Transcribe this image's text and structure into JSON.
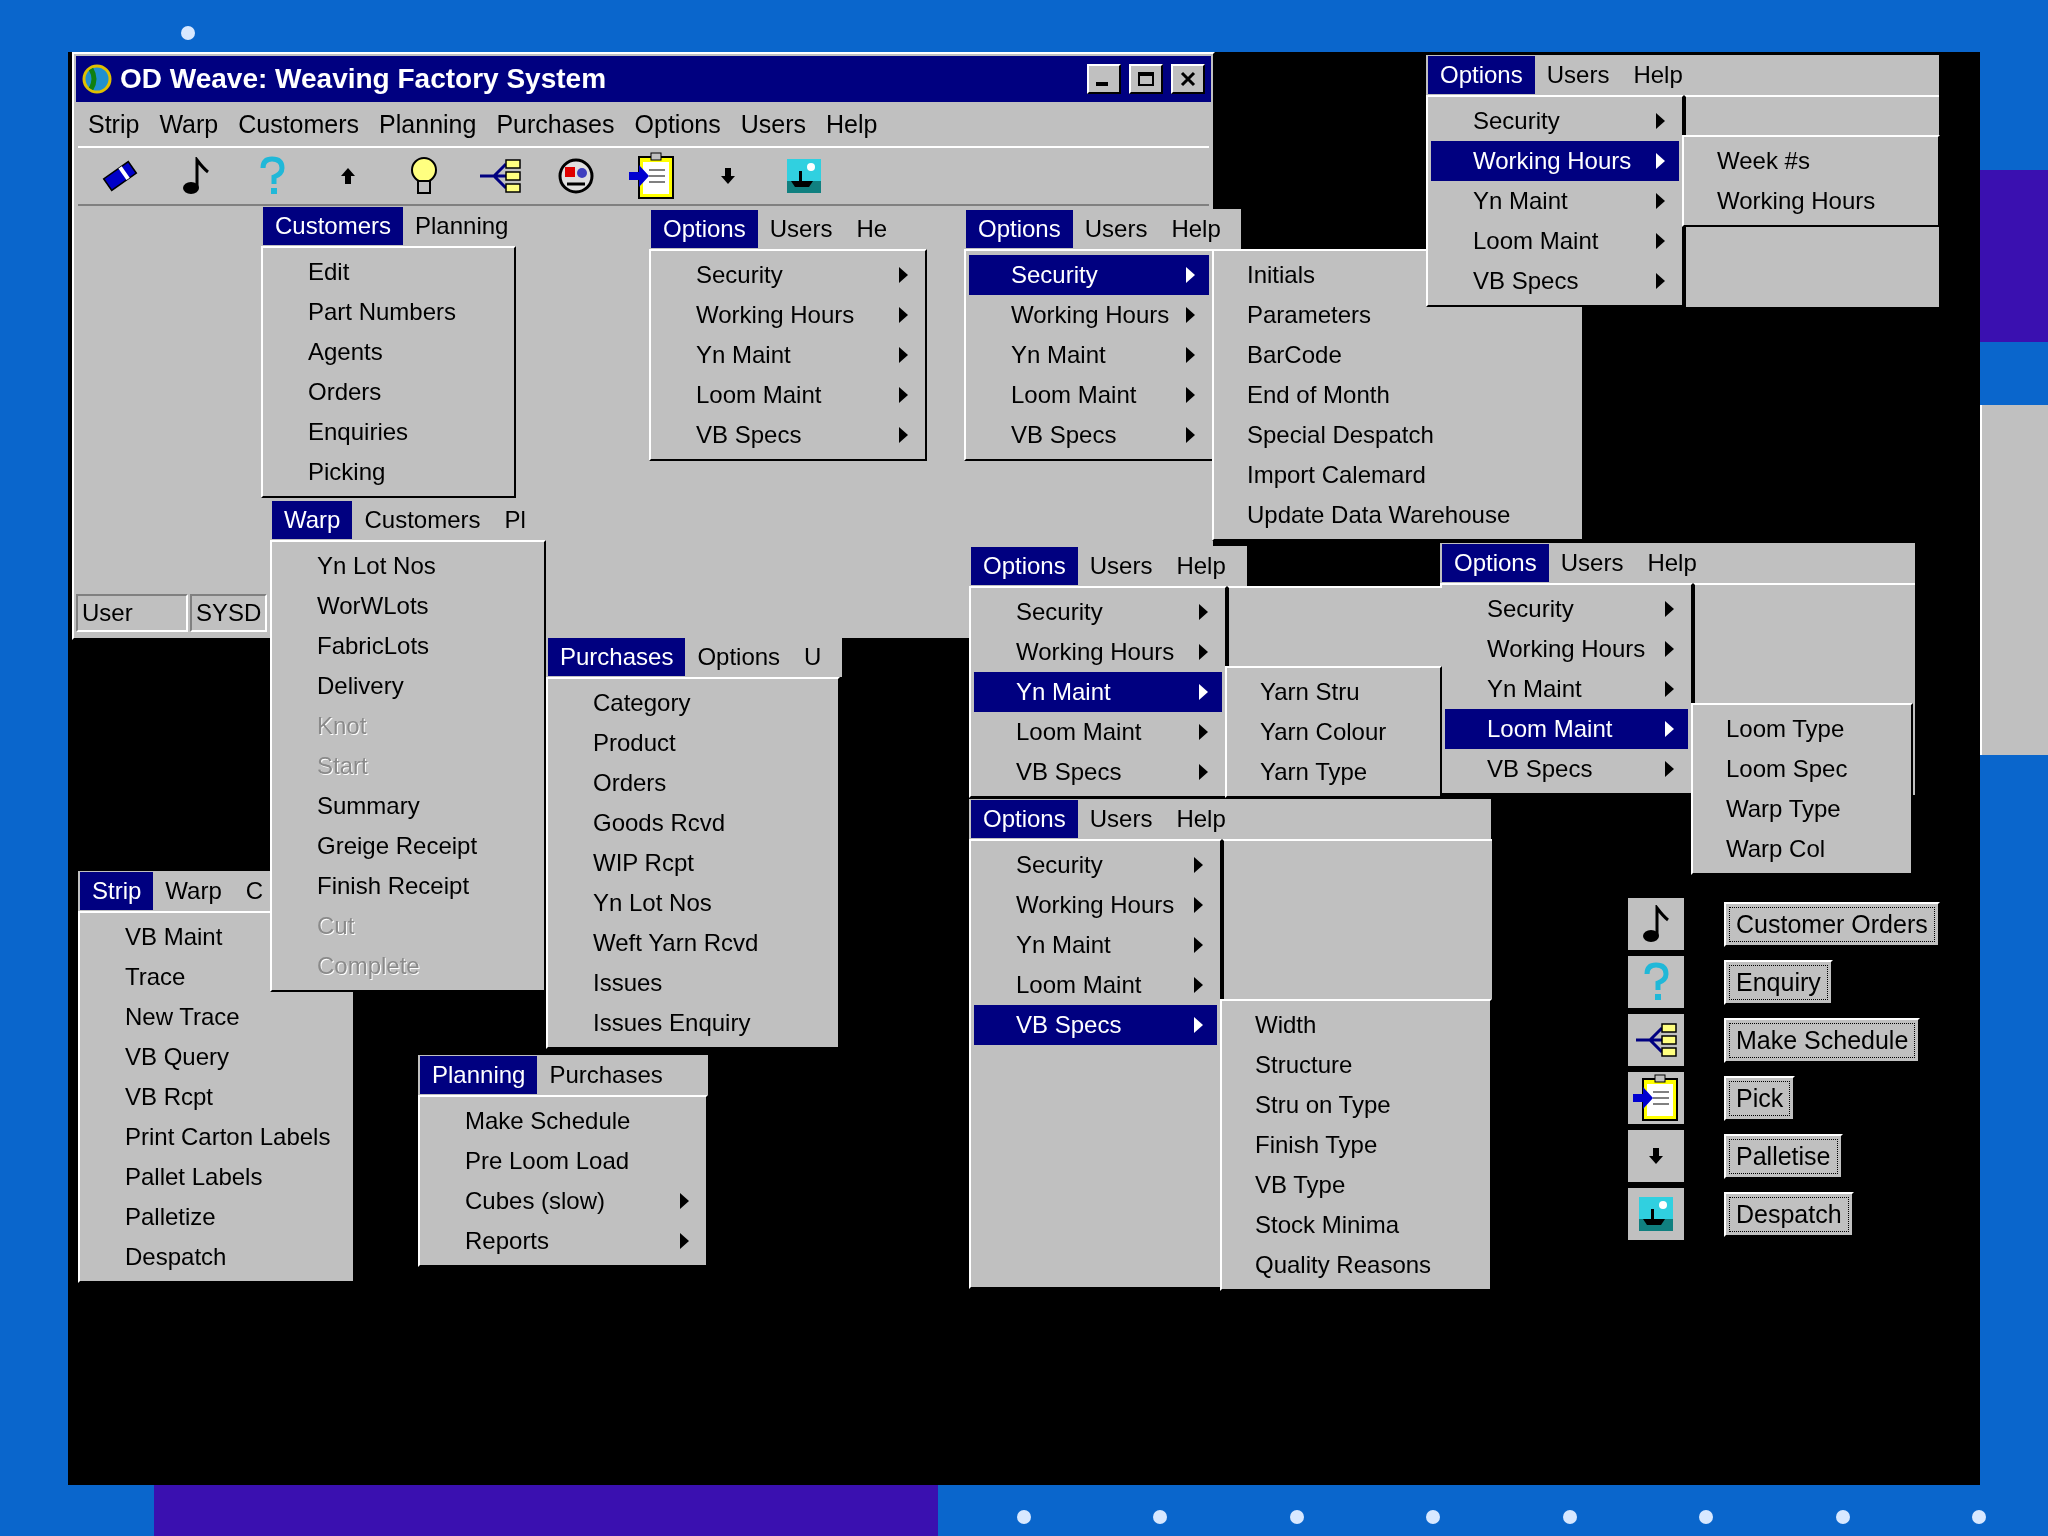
{
  "main_window": {
    "title": "OD Weave: Weaving Factory System",
    "menu_bar": [
      {
        "label": "Strip",
        "selected": false
      },
      {
        "label": "Warp",
        "selected": false
      },
      {
        "label": "Customers",
        "selected": false
      },
      {
        "label": "Planning",
        "selected": false
      },
      {
        "label": "Purchases",
        "selected": false
      },
      {
        "label": "Options",
        "selected": false
      },
      {
        "label": "Users",
        "selected": false
      },
      {
        "label": "Help",
        "selected": false
      }
    ],
    "status_fields": [
      "User",
      "SYSD"
    ]
  },
  "menus": [
    {
      "bar": [
        {
          "label": "Customers",
          "selected": true
        },
        {
          "label": "Planning",
          "selected": false
        }
      ],
      "items": [
        {
          "label": "Edit"
        },
        {
          "label": "Part Numbers"
        },
        {
          "label": "Agents"
        },
        {
          "label": "Orders"
        },
        {
          "label": "Enquiries"
        },
        {
          "label": "Picking"
        }
      ]
    },
    {
      "bar": [
        {
          "label": "Options",
          "selected": true
        },
        {
          "label": "Users",
          "selected": false
        },
        {
          "label": "He",
          "selected": false
        }
      ],
      "items": [
        {
          "label": "Security",
          "has_submenu": true
        },
        {
          "label": "Working Hours",
          "has_submenu": true
        },
        {
          "label": "Yn Maint",
          "has_submenu": true
        },
        {
          "label": "Loom Maint",
          "has_submenu": true
        },
        {
          "label": "VB Specs",
          "has_submenu": true
        }
      ]
    },
    {
      "bar": [
        {
          "label": "Options",
          "selected": true
        },
        {
          "label": "Users",
          "selected": false
        },
        {
          "label": "Help",
          "selected": false
        }
      ],
      "items": [
        {
          "label": "Security",
          "has_submenu": true,
          "selected": true
        },
        {
          "label": "Working Hours",
          "has_submenu": true,
          "selected": false
        },
        {
          "label": "Yn Maint",
          "has_submenu": true,
          "selected": false
        },
        {
          "label": "Loom Maint",
          "has_submenu": true,
          "selected": false
        },
        {
          "label": "VB Specs",
          "has_submenu": true,
          "selected": false
        }
      ],
      "submenu": [
        "Initials",
        "Parameters",
        "BarCode",
        "End of Month",
        "Special Despatch",
        "Import Calemard",
        "Update Data Warehouse"
      ]
    },
    {
      "bar": [
        {
          "label": "Options",
          "selected": true
        },
        {
          "label": "Users",
          "selected": false
        },
        {
          "label": "Help",
          "selected": false
        }
      ],
      "items": [
        {
          "label": "Security",
          "has_submenu": true,
          "selected": false
        },
        {
          "label": "Working Hours",
          "has_submenu": true,
          "selected": true
        },
        {
          "label": "Yn Maint",
          "has_submenu": true,
          "selected": false
        },
        {
          "label": "Loom Maint",
          "has_submenu": true,
          "selected": false
        },
        {
          "label": "VB Specs",
          "has_submenu": true,
          "selected": false
        }
      ],
      "submenu": [
        "Week #s",
        "Working Hours"
      ]
    },
    {
      "bar": [
        {
          "label": "Warp",
          "selected": true
        },
        {
          "label": "Customers",
          "selected": false
        },
        {
          "label": "Pl",
          "selected": false
        }
      ],
      "items": [
        {
          "label": "Yn Lot Nos",
          "disabled": false
        },
        {
          "label": "WorWLots",
          "disabled": false
        },
        {
          "label": "FabricLots",
          "disabled": false
        },
        {
          "label": "Delivery",
          "disabled": false
        },
        {
          "label": "Knot",
          "disabled": true
        },
        {
          "label": "Start",
          "disabled": true
        },
        {
          "label": "Summary",
          "disabled": false
        },
        {
          "label": "Greige Receipt",
          "disabled": false
        },
        {
          "label": "Finish Receipt",
          "disabled": false
        },
        {
          "label": "Cut",
          "disabled": true
        },
        {
          "label": "Complete",
          "disabled": true
        }
      ]
    },
    {
      "bar": [
        {
          "label": "Purchases",
          "selected": true
        },
        {
          "label": "Options",
          "selected": false
        },
        {
          "label": "U",
          "selected": false
        }
      ],
      "items": [
        {
          "label": "Category"
        },
        {
          "label": "Product"
        },
        {
          "label": "Orders"
        },
        {
          "label": "Goods Rcvd"
        },
        {
          "label": "WIP Rcpt"
        },
        {
          "label": "Yn Lot Nos"
        },
        {
          "label": "Weft Yarn Rcvd"
        },
        {
          "label": "Issues"
        },
        {
          "label": "Issues Enquiry"
        }
      ]
    },
    {
      "bar": [
        {
          "label": "Strip",
          "selected": true
        },
        {
          "label": "Warp",
          "selected": false
        },
        {
          "label": "C",
          "selected": false
        }
      ],
      "items": [
        {
          "label": "VB Maint"
        },
        {
          "label": "Trace"
        },
        {
          "label": "New Trace"
        },
        {
          "label": "VB Query"
        },
        {
          "label": "VB Rcpt"
        },
        {
          "label": "Print Carton Labels"
        },
        {
          "label": "Pallet Labels"
        },
        {
          "label": "Palletize"
        },
        {
          "label": "Despatch"
        }
      ]
    },
    {
      "bar": [
        {
          "label": "Planning",
          "selected": true
        },
        {
          "label": "Purchases",
          "selected": false
        }
      ],
      "items": [
        {
          "label": "Make Schedule",
          "has_submenu": false
        },
        {
          "label": "Pre Loom Load",
          "has_submenu": false
        },
        {
          "label": "Cubes (slow)",
          "has_submenu": true
        },
        {
          "label": "Reports",
          "has_submenu": true
        }
      ]
    },
    {
      "bar": [
        {
          "label": "Options",
          "selected": true
        },
        {
          "label": "Users",
          "selected": false
        },
        {
          "label": "Help",
          "selected": false
        }
      ],
      "items": [
        {
          "label": "Security",
          "has_submenu": true,
          "selected": false
        },
        {
          "label": "Working Hours",
          "has_submenu": true,
          "selected": false
        },
        {
          "label": "Yn Maint",
          "has_submenu": true,
          "selected": true
        },
        {
          "label": "Loom Maint",
          "has_submenu": true,
          "selected": false
        },
        {
          "label": "VB Specs",
          "has_submenu": true,
          "selected": false
        }
      ],
      "submenu": [
        "Yarn Stru",
        "Yarn Colour",
        "Yarn Type"
      ]
    },
    {
      "bar": [
        {
          "label": "Options",
          "selected": true
        },
        {
          "label": "Users",
          "selected": false
        },
        {
          "label": "Help",
          "selected": false
        }
      ],
      "items": [
        {
          "label": "Security",
          "has_submenu": true,
          "selected": false
        },
        {
          "label": "Working Hours",
          "has_submenu": true,
          "selected": false
        },
        {
          "label": "Yn Maint",
          "has_submenu": true,
          "selected": false
        },
        {
          "label": "Loom Maint",
          "has_submenu": true,
          "selected": true
        },
        {
          "label": "VB Specs",
          "has_submenu": true,
          "selected": false
        }
      ],
      "submenu": [
        "Loom Type",
        "Loom Spec",
        "Warp Type",
        "Warp Col"
      ]
    },
    {
      "bar": [
        {
          "label": "Options",
          "selected": true
        },
        {
          "label": "Users",
          "selected": false
        },
        {
          "label": "Help",
          "selected": false
        }
      ],
      "items": [
        {
          "label": "Security",
          "has_submenu": true,
          "selected": false
        },
        {
          "label": "Working Hours",
          "has_submenu": true,
          "selected": false
        },
        {
          "label": "Yn Maint",
          "has_submenu": true,
          "selected": false
        },
        {
          "label": "Loom Maint",
          "has_submenu": true,
          "selected": false
        },
        {
          "label": "VB Specs",
          "has_submenu": true,
          "selected": true
        }
      ],
      "submenu": [
        "Width",
        "Structure",
        "Stru on Type",
        "Finish Type",
        "VB Type",
        "Stock Minima",
        "Quality Reasons"
      ]
    }
  ],
  "shortcut_buttons": [
    "Customer Orders",
    "Enquiry",
    "Make Schedule",
    "Pick",
    "Palletise",
    "Despatch"
  ]
}
